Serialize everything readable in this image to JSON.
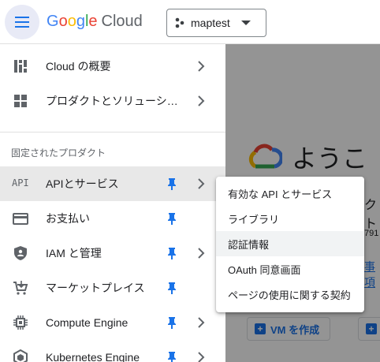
{
  "header": {
    "logo_google": [
      "G",
      "o",
      "o",
      "g",
      "l",
      "e"
    ],
    "logo_colors": [
      "#4285F4",
      "#EA4335",
      "#FBBC05",
      "#4285F4",
      "#34A853",
      "#EA4335"
    ],
    "logo_cloud": "Cloud",
    "project_name": "maptest"
  },
  "sidebar": {
    "top_items": [
      {
        "label": "Cloud の概要",
        "icon": "dashboard-icon"
      },
      {
        "label": "プロダクトとソリューシ…",
        "icon": "apps-grid-icon"
      }
    ],
    "pinned_section_label": "固定されたプロダクト",
    "pinned_items": [
      {
        "label": "APIとサービス",
        "icon": "api-icon"
      },
      {
        "label": "お支払い",
        "icon": "billing-icon"
      },
      {
        "label": "IAM と管理",
        "icon": "shield-icon"
      },
      {
        "label": "マーケットプレイス",
        "icon": "marketplace-icon"
      },
      {
        "label": "Compute Engine",
        "icon": "compute-engine-icon"
      },
      {
        "label": "Kubernetes Engine",
        "icon": "kubernetes-icon"
      }
    ],
    "api_icon_text": "API"
  },
  "flyout": {
    "items": [
      "有効な API とサービス",
      "ライブラリ",
      "認証情報",
      "OAuth 同意画面",
      "ページの使用に関する契約"
    ]
  },
  "main": {
    "welcome": "ようこ",
    "frag1": "クト",
    "frag2": "791",
    "frag3": "事項",
    "vm_button": "VM を作成"
  },
  "colors": {
    "accent": "#1a73e8",
    "pin": "#1a73e8",
    "active_bg": "#e8e8e8"
  }
}
